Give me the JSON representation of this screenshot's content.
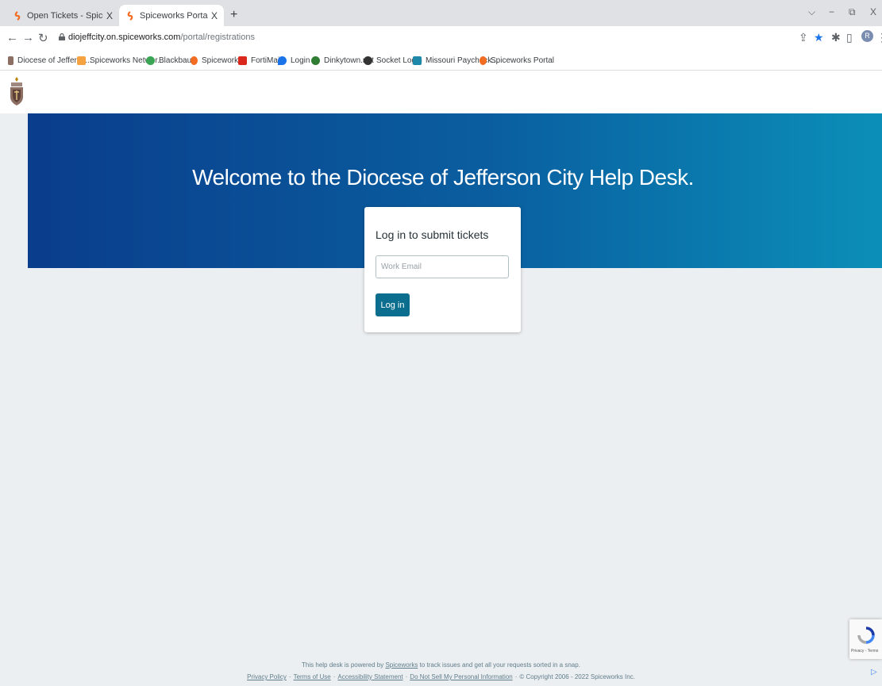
{
  "browser": {
    "tabs": [
      {
        "title": "Open Tickets - Spiceworks Help D",
        "close": "X"
      },
      {
        "title": "Spiceworks Portal",
        "close": "X"
      }
    ],
    "new_tab": "+",
    "window_controls": {
      "chevron": "⌵",
      "minimize": "−",
      "restore": "⧉",
      "close": "X"
    },
    "address": {
      "domain": "diojeffcity.on.spiceworks.com",
      "path": "/portal/registrations"
    },
    "profile_initial": "R",
    "bookmarks": [
      {
        "label": "Diocese of Jefferso...",
        "color": "#8d6e63"
      },
      {
        "label": "Spiceworks Networ...",
        "color": "#f4a340"
      },
      {
        "label": "Blackbaud",
        "color": "#3aa655"
      },
      {
        "label": "Spiceworks",
        "color": "#f26c21"
      },
      {
        "label": "FortiMail",
        "color": "#da291c"
      },
      {
        "label": "Login",
        "color": "#1a73e8"
      },
      {
        "label": "Dinkytown.net",
        "color": "#2e7d32"
      },
      {
        "label": "Socket Login",
        "color": "#333333"
      },
      {
        "label": "Missouri Paycheck...",
        "color": "#1e88a8"
      },
      {
        "label": "Spiceworks Portal",
        "color": "#f26c21"
      }
    ]
  },
  "page": {
    "hero_title": "Welcome to the Diocese of Jefferson City Help Desk.",
    "login": {
      "title": "Log in to submit tickets",
      "email_placeholder": "Work Email",
      "button_label": "Log in"
    },
    "footer": {
      "line1_pre": "This help desk is powered by",
      "spiceworks_link": "Spiceworks",
      "line1_post": "to track issues and get all your requests sorted in a snap.",
      "links": [
        "Privacy Policy",
        "Terms of Use",
        "Accessibility Statement",
        "Do Not Sell My Personal Information"
      ],
      "copyright": "© Copyright 2006 - 2022 Spiceworks Inc."
    },
    "recaptcha_text": "Privacy - Terms"
  },
  "colors": {
    "hero_start": "#0a3d8c",
    "hero_end": "#0b8fb8",
    "button": "#0b6e8f",
    "page_bg": "#eceff1"
  }
}
